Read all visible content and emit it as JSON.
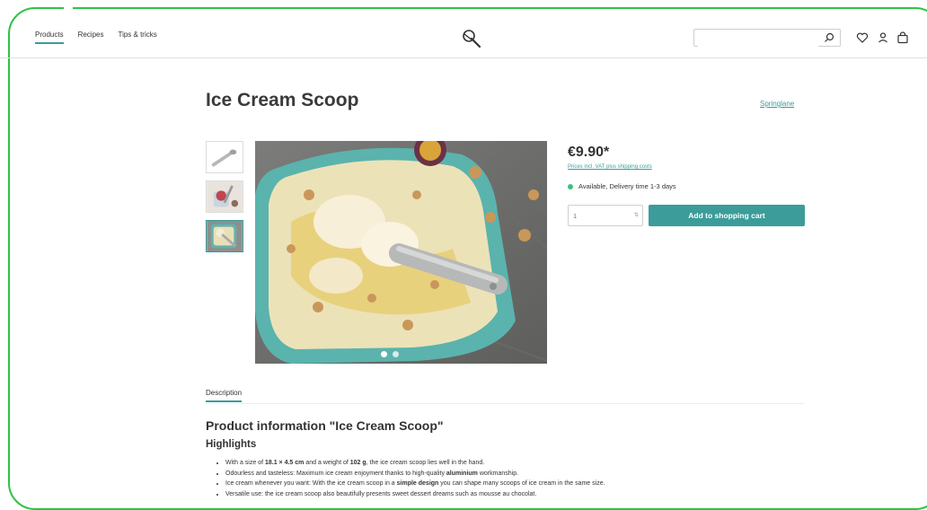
{
  "nav": {
    "items": [
      {
        "label": "Products",
        "active": true
      },
      {
        "label": "Recipes",
        "active": false
      },
      {
        "label": "Tips & tricks",
        "active": false
      }
    ]
  },
  "header": {
    "logo_icon": "ice-cream-scoop-logo",
    "search_placeholder": "",
    "icons": [
      "search-icon",
      "heart-icon",
      "user-icon",
      "bag-icon"
    ]
  },
  "product": {
    "title": "Ice Cream Scoop",
    "brand": "Springlane",
    "price": "€9.90*",
    "vat_note": "Prices incl. VAT plus shipping costs",
    "availability": "Available, Delivery time 1-3 days",
    "quantity": "1",
    "cart_label": "Add to shopping cart",
    "accent_color": "#3b9c9a",
    "available_color": "#3dc27a"
  },
  "gallery": {
    "active_thumb": 3,
    "dot_count": 2
  },
  "description": {
    "tab_label": "Description",
    "heading": "Product information \"Ice Cream Scoop\"",
    "highlights_heading": "Highlights",
    "bullets": [
      [
        "With a size of ",
        "18.1 × 4.5 cm",
        " and a weight of ",
        "102 g",
        ", the ice cream scoop lies well in the hand."
      ],
      [
        "Odourless and tasteless: Maximum ice cream enjoyment thanks to high-quality ",
        "aluminium",
        " workmanship."
      ],
      [
        "Ice cream whenever you want: With the ice cream scoop in a ",
        "simple design",
        " you can shape many scoops of ice cream in the same size."
      ],
      [
        "Versatile use: the ice cream scoop also beautifully presents sweet dessert dreams such as mousse au chocolat."
      ]
    ]
  }
}
